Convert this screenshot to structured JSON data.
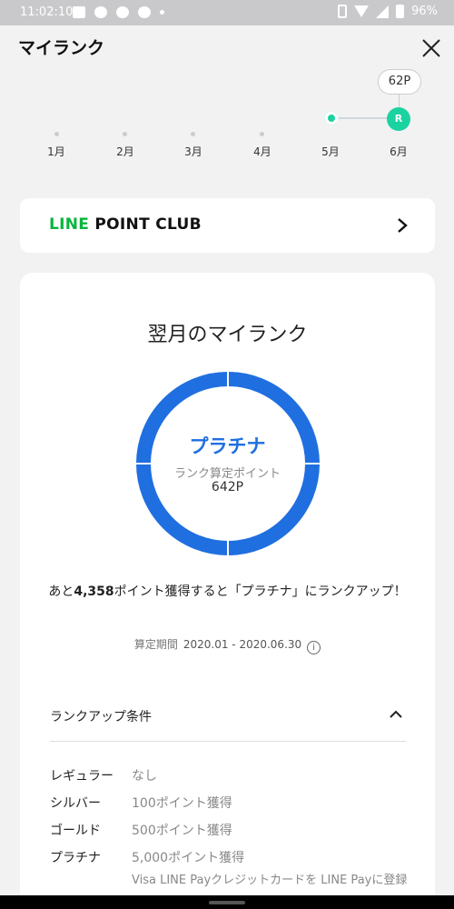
{
  "status_bar": {
    "time": "11:02:10",
    "battery": "96%"
  },
  "header": {
    "title": "マイランク"
  },
  "timeline": {
    "tooltip": "62P",
    "current_rank_letter": "R",
    "months": [
      "1月",
      "2月",
      "3月",
      "4月",
      "5月",
      "6月"
    ]
  },
  "club": {
    "logo_line": "LINE ",
    "logo_rest": "POINT CLUB"
  },
  "rank_card": {
    "heading": "翌月のマイランク",
    "rank_name": "プラチナ",
    "points_label": "ランク算定ポイント",
    "points_value": "642P",
    "ring_color": "#1f6fe0",
    "message_pre": "あと",
    "message_points": "4,358",
    "message_post": "ポイント獲得すると「プラチナ」にランクアップ！",
    "period_label": "算定期間",
    "period_value": "2020.01 - 2020.06.30",
    "info_icon": "i"
  },
  "conditions": {
    "heading": "ランクアップ条件",
    "rows": [
      {
        "rank": "レギュラー",
        "requirement": "なし"
      },
      {
        "rank": "シルバー",
        "requirement": "100ポイント獲得"
      },
      {
        "rank": "ゴールド",
        "requirement": "500ポイント獲得"
      },
      {
        "rank": "プラチナ",
        "requirement": "5,000ポイント獲得",
        "extra": "Visa LINE Payクレジットカードを LINE Payに登録"
      }
    ]
  },
  "colors": {
    "accent_green": "#1bd3a0",
    "line_green": "#07b53b",
    "rank_blue": "#1f6fe0"
  }
}
